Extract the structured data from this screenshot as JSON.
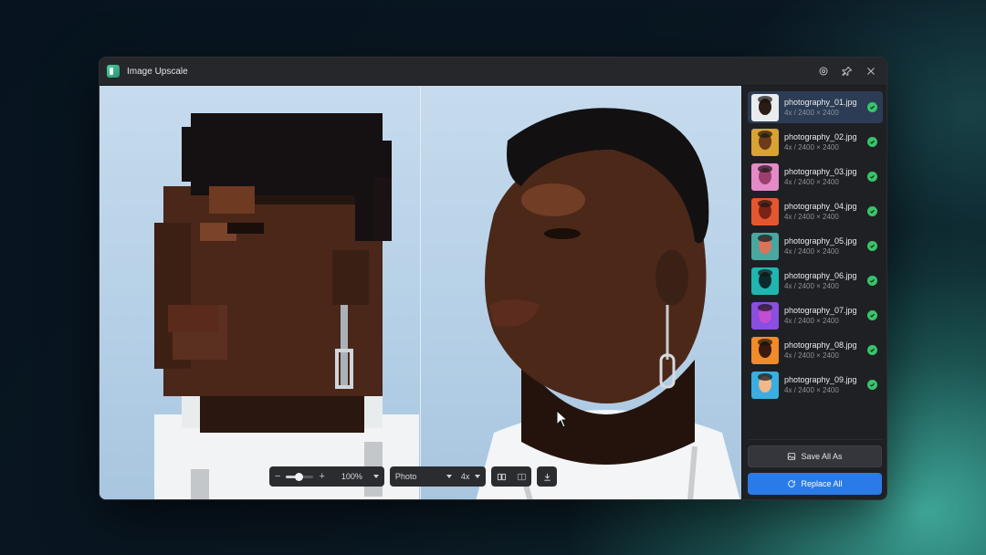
{
  "app": {
    "title": "Image Upscale"
  },
  "titlebar": {
    "icons": [
      "settings-icon",
      "pin-icon",
      "close-icon"
    ]
  },
  "toolbar": {
    "zoom_minus": "−",
    "zoom_plus": "+",
    "zoom_level": "100%",
    "zoom_slider_fraction": 0.45,
    "model": "Photo",
    "scale": "4x",
    "icons": [
      "side-by-side-view-icon",
      "split-view-icon",
      "download-icon"
    ]
  },
  "files": [
    {
      "name": "photography_01.jpg",
      "info": "4x / 2400 × 2400",
      "active": true,
      "thumb": [
        "#e9ecef",
        "#2a1b14"
      ]
    },
    {
      "name": "photography_02.jpg",
      "info": "4x / 2400 × 2400",
      "active": false,
      "thumb": [
        "#d9a233",
        "#6b3b1a"
      ]
    },
    {
      "name": "photography_03.jpg",
      "info": "4x / 2400 × 2400",
      "active": false,
      "thumb": [
        "#e48ac7",
        "#9a3f6e"
      ]
    },
    {
      "name": "photography_04.jpg",
      "info": "4x / 2400 × 2400",
      "active": false,
      "thumb": [
        "#e4572e",
        "#7a2418"
      ]
    },
    {
      "name": "photography_05.jpg",
      "info": "4x / 2400 × 2400",
      "active": false,
      "thumb": [
        "#4aa7a0",
        "#d9735a"
      ]
    },
    {
      "name": "photography_06.jpg",
      "info": "4x / 2400 × 2400",
      "active": false,
      "thumb": [
        "#1fb6b0",
        "#0c2a2d"
      ]
    },
    {
      "name": "photography_07.jpg",
      "info": "4x / 2400 × 2400",
      "active": false,
      "thumb": [
        "#8a4ee0",
        "#c24fd3"
      ]
    },
    {
      "name": "photography_08.jpg",
      "info": "4x / 2400 × 2400",
      "active": false,
      "thumb": [
        "#f08a2a",
        "#3a1a10"
      ]
    },
    {
      "name": "photography_09.jpg",
      "info": "4x / 2400 × 2400",
      "active": false,
      "thumb": [
        "#3aaee0",
        "#f2b78a"
      ]
    }
  ],
  "actions": {
    "save_all": "Save All As",
    "replace_all": "Replace All"
  },
  "colors": {
    "accent": "#2b7be6",
    "success": "#39c46a",
    "active_row": "#2d3c55"
  }
}
